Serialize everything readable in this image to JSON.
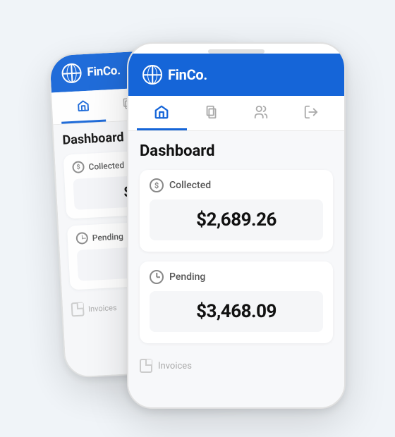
{
  "app": {
    "name": "FinCo.",
    "brand_color": "#1565d8"
  },
  "nav": {
    "items": [
      {
        "label": "Home",
        "icon": "home-icon",
        "active": true
      },
      {
        "label": "Documents",
        "icon": "documents-icon",
        "active": false
      },
      {
        "label": "Users",
        "icon": "users-icon",
        "active": false
      },
      {
        "label": "Logout",
        "icon": "logout-icon",
        "active": false
      }
    ]
  },
  "dashboard": {
    "title": "Dashboard",
    "cards": [
      {
        "label": "Collected",
        "icon_type": "dollar",
        "value": "$2,689.26"
      },
      {
        "label": "Pending",
        "icon_type": "clock",
        "value": "$3,468.09"
      }
    ],
    "invoices_label": "Invoices"
  }
}
